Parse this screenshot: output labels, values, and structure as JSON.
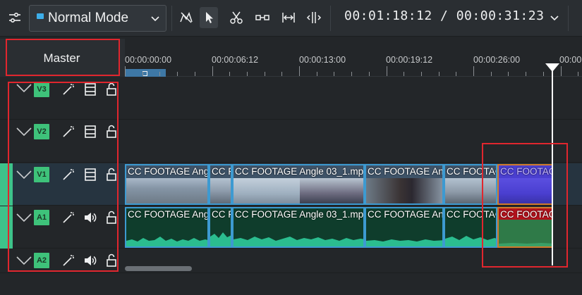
{
  "toolbar": {
    "mode_label": "Normal Mode",
    "timecode": "00:01:18:12 / 00:00:31:23",
    "accent": "#3daee9"
  },
  "header": {
    "master_label": "Master"
  },
  "ruler": {
    "labels": [
      "00:00:00:00",
      "00:00:06:12",
      "00:00:13:00",
      "00:00:19:12",
      "00:00:26:00",
      "00:00"
    ]
  },
  "tracks": [
    {
      "badge": "V3",
      "type": "video"
    },
    {
      "badge": "V2",
      "type": "video"
    },
    {
      "badge": "V1",
      "type": "video"
    },
    {
      "badge": "A1",
      "type": "audio"
    },
    {
      "badge": "A2",
      "type": "audio"
    }
  ],
  "clips": {
    "v1": [
      {
        "title": "CC FOOTAGE Ang"
      },
      {
        "title": "CC F"
      },
      {
        "title": "CC FOOTAGE Angle 03_1.mp"
      },
      {
        "title": "CC FOOTAGE Angl"
      },
      {
        "title": "CC FOOTAG"
      },
      {
        "title": "CC FOOTAGE"
      }
    ],
    "a1": [
      {
        "title": "CC FOOTAGE Ang"
      },
      {
        "title": "CC F"
      },
      {
        "title": "CC FOOTAGE Angle 03_1.mp"
      },
      {
        "title": "CC FOOTAGE Angl"
      },
      {
        "title": "CC FOOTAG"
      },
      {
        "title": "CC FOOTAG"
      }
    ]
  },
  "colors": {
    "highlight": "#e0262e",
    "track_green": "#3ec27a",
    "clip_border": "#3d9ad1",
    "selected_clip_border": "#d07a2c"
  }
}
